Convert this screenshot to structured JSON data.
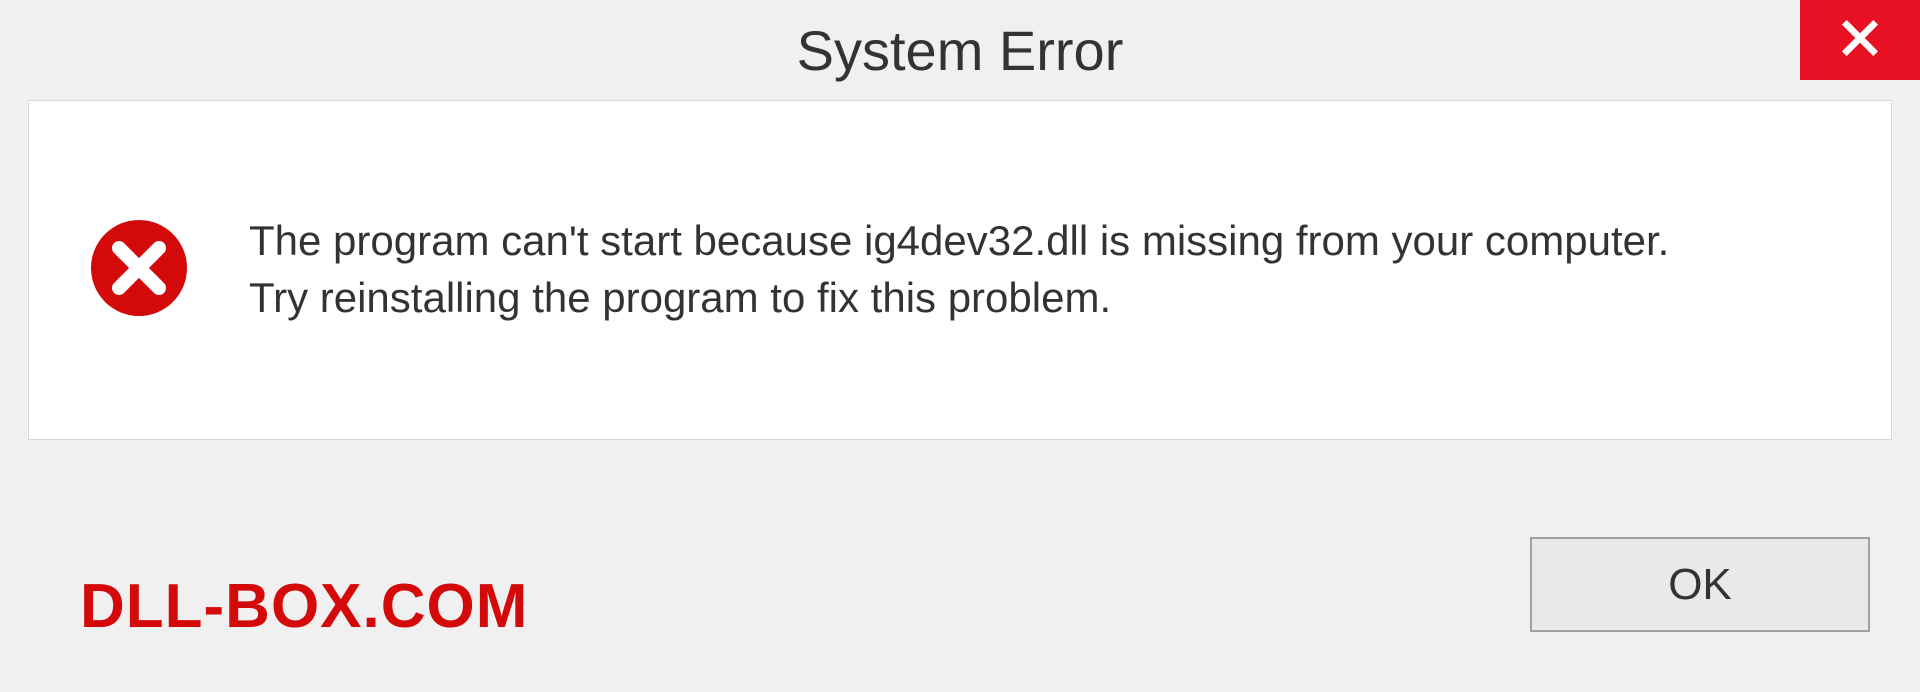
{
  "dialog": {
    "title": "System Error",
    "message_line1": "The program can't start because ig4dev32.dll is missing from your computer.",
    "message_line2": "Try reinstalling the program to fix this problem.",
    "ok_label": "OK"
  },
  "watermark": {
    "text": "DLL-BOX.COM"
  },
  "colors": {
    "close_button_bg": "#e81123",
    "error_icon_bg": "#d40a0a",
    "watermark_color": "#d40a0a"
  }
}
